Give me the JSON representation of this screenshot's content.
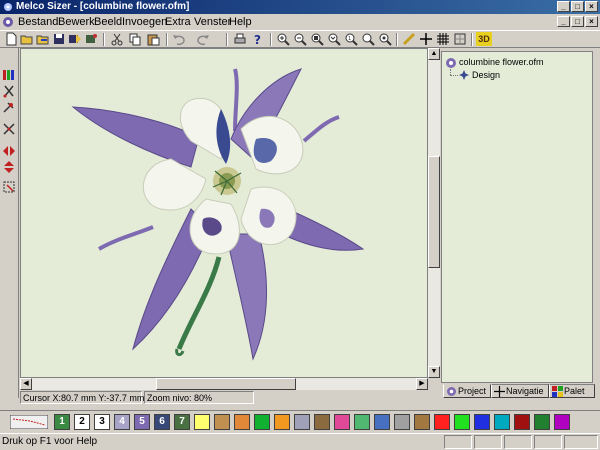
{
  "window": {
    "title": "Melco Sizer - [columbine flower.ofm]",
    "minimize": "_",
    "maximize": "□",
    "close": "×"
  },
  "menubar": {
    "items": [
      "Bestand",
      "Bewerk",
      "Beeld",
      "Invoegen",
      "Extra",
      "Venster",
      "Help"
    ],
    "underlines": [
      "B",
      "w",
      "l",
      "I",
      "x",
      "V",
      "H"
    ]
  },
  "toolbar": {
    "icons": [
      "new-icon",
      "open-icon",
      "open-folder-icon",
      "save-icon",
      "import-icon",
      "export-icon",
      "cut-icon",
      "copy-icon",
      "paste-icon",
      "undo-icon",
      "redo-icon",
      "print-icon",
      "help-icon",
      "zoom-in-icon",
      "zoom-out-icon",
      "zoom-fit-icon",
      "zoom-window-icon",
      "zoom-1to1-icon",
      "zoom-previous-icon",
      "zoom-realsize-icon",
      "ruler-icon",
      "crosshair-icon",
      "grid-icon",
      "hoop-icon"
    ],
    "threed_label": "3D"
  },
  "left_tools": [
    "color-bars-icon",
    "scissors-icon",
    "pin-icon",
    "cut-cross-icon",
    "mirror-horizontal-icon",
    "mirror-vertical-icon",
    "select-icon"
  ],
  "tree": {
    "root": "columbine flower.ofm",
    "child": "Design"
  },
  "tabs": {
    "project": "Project",
    "navigatie": "Navigatie",
    "palet": "Palet"
  },
  "status": {
    "cursor": "Cursor X:80.7 mm Y:-37.7 mm",
    "zoom": "Zoom nivo: 80%",
    "help": "Druk op F1 voor Help"
  },
  "palette": {
    "swatches": [
      {
        "color": "#f0f0f0",
        "label": ""
      },
      {
        "color": "#3a8a44",
        "label": "1"
      },
      {
        "color": "#ffffff",
        "label": "2"
      },
      {
        "color": "#ffffff",
        "label": "3"
      },
      {
        "color": "#a8a4c8",
        "label": "4"
      },
      {
        "color": "#7e6ab0",
        "label": "5"
      },
      {
        "color": "#384878",
        "label": "6"
      },
      {
        "color": "#487040",
        "label": "7"
      },
      {
        "color": "#ffff70",
        "label": ""
      },
      {
        "color": "#c09050",
        "label": ""
      },
      {
        "color": "#e08838",
        "label": ""
      },
      {
        "color": "#10b030",
        "label": ""
      },
      {
        "color": "#f09820",
        "label": ""
      },
      {
        "color": "#a0a0b8",
        "label": ""
      },
      {
        "color": "#8b6a40",
        "label": ""
      },
      {
        "color": "#e04898",
        "label": ""
      },
      {
        "color": "#50b870",
        "label": ""
      },
      {
        "color": "#4870c0",
        "label": ""
      },
      {
        "color": "#a0a0a0",
        "label": ""
      },
      {
        "color": "#a07840",
        "label": ""
      },
      {
        "color": "#ff2020",
        "label": ""
      },
      {
        "color": "#20e020",
        "label": ""
      },
      {
        "color": "#2030e0",
        "label": ""
      },
      {
        "color": "#00a8c0",
        "label": ""
      },
      {
        "color": "#a01010",
        "label": ""
      },
      {
        "color": "#208030",
        "label": ""
      },
      {
        "color": "#b000c0",
        "label": ""
      }
    ]
  },
  "colors": {
    "canvas_bg": "#e4ecd8",
    "petal_purple": "#7e6ab0",
    "petal_white": "#f4f6ee",
    "stem_green": "#3a7a48",
    "title_gradient_start": "#0a246a"
  }
}
